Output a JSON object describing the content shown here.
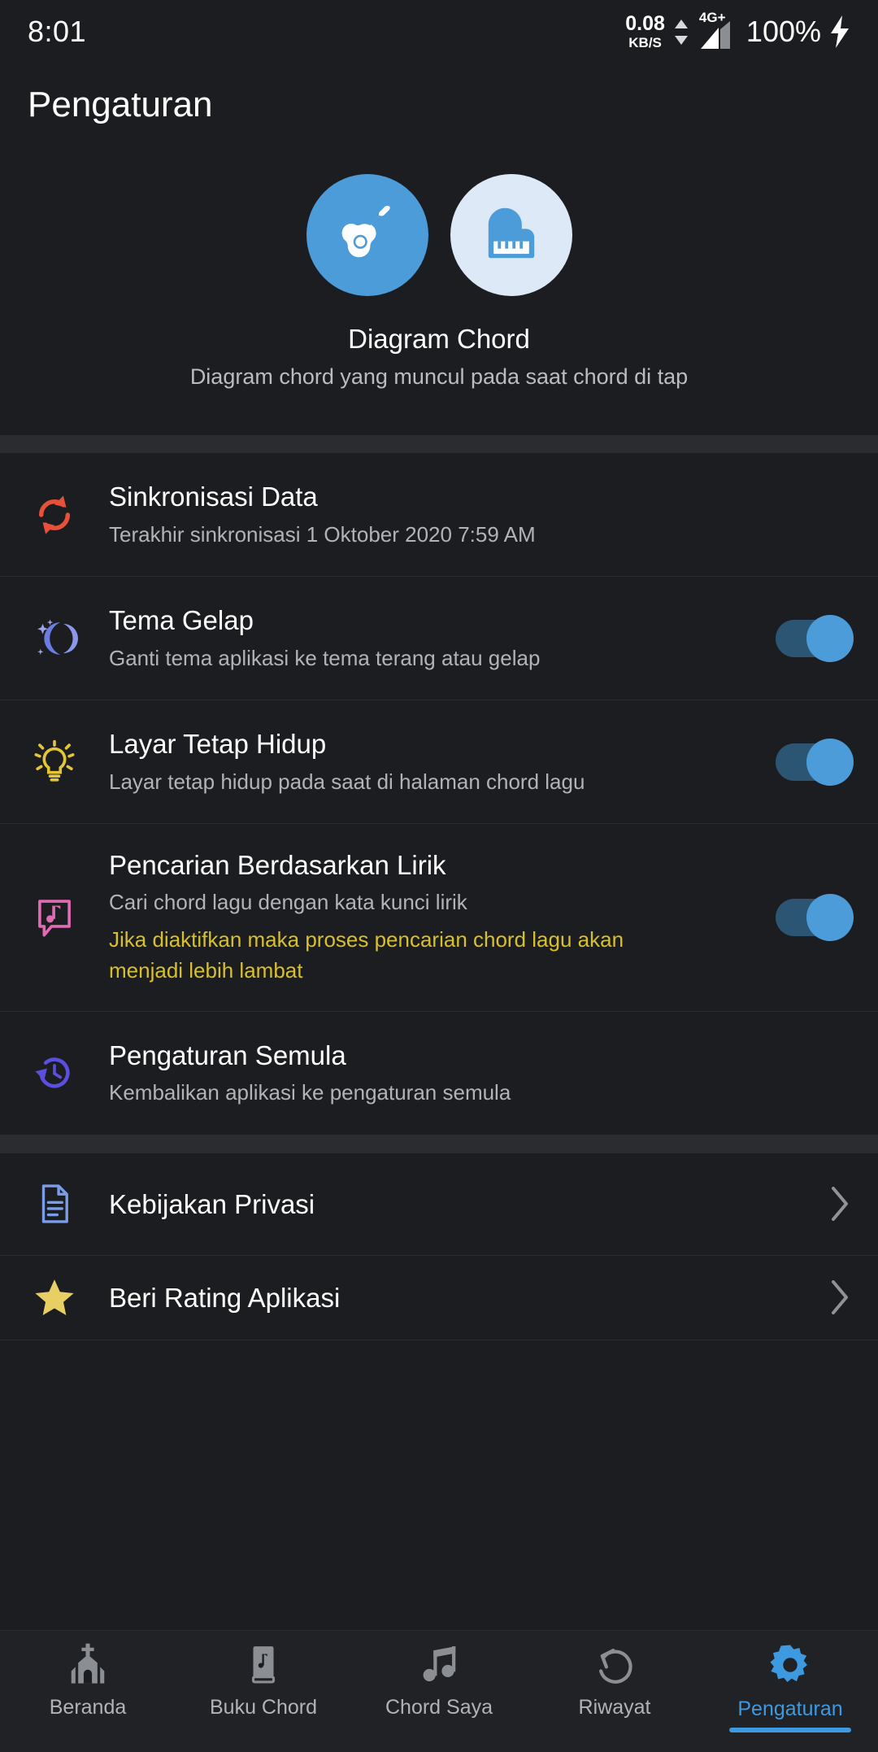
{
  "statusbar": {
    "time": "8:01",
    "net_speed_value": "0.08",
    "net_speed_unit": "KB/S",
    "network_type": "4G+",
    "battery": "100%",
    "charging_icon": "lightning-bolt-icon"
  },
  "header": {
    "title": "Pengaturan"
  },
  "hero": {
    "guitar_icon": "guitar-icon",
    "piano_icon": "piano-icon",
    "title": "Diagram Chord",
    "subtitle": "Diagram chord yang muncul pada saat chord di tap",
    "guitar_circle_color": "#4b9cd8",
    "piano_circle_color": "#dde9f6"
  },
  "settings": {
    "sync": {
      "icon": "sync-icon",
      "icon_color": "#e8503a",
      "title": "Sinkronisasi Data",
      "subtitle": "Terakhir sinkronisasi 1 Oktober 2020 7:59 AM"
    },
    "dark_theme": {
      "icon": "moon-stars-icon",
      "icon_color": "#6d7ce0",
      "title": "Tema Gelap",
      "subtitle": "Ganti tema aplikasi ke tema terang atau gelap",
      "toggle_state": "on"
    },
    "keep_screen_on": {
      "icon": "lightbulb-icon",
      "icon_color": "#e3c53a",
      "title": "Layar Tetap Hidup",
      "subtitle": "Layar tetap hidup pada saat di halaman chord lagu",
      "toggle_state": "on"
    },
    "lyric_search": {
      "icon": "music-chat-icon",
      "icon_color": "#e06bb4",
      "title": "Pencarian Berdasarkan Lirik",
      "subtitle": "Cari chord lagu dengan kata kunci lirik",
      "warning": "Jika diaktifkan maka proses pencarian chord lagu akan menjadi lebih lambat",
      "warning_color": "#d6c02e",
      "toggle_state": "on"
    },
    "reset": {
      "icon": "history-restore-icon",
      "icon_color": "#5b4fe0",
      "title": "Pengaturan Semula",
      "subtitle": "Kembalikan aplikasi ke pengaturan semula"
    },
    "privacy": {
      "icon": "document-icon",
      "icon_color": "#7b9de8",
      "title": "Kebijakan Privasi",
      "chevron": "chevron-right-icon"
    },
    "rating": {
      "icon": "star-icon",
      "icon_color": "#e8cf63",
      "title": "Beri Rating Aplikasi",
      "chevron": "chevron-right-icon"
    }
  },
  "bottom_nav": {
    "active_color": "#3d9ae0",
    "items": [
      {
        "label": "Beranda",
        "icon": "church-icon",
        "active": false
      },
      {
        "label": "Buku Chord",
        "icon": "chord-book-icon",
        "active": false
      },
      {
        "label": "Chord Saya",
        "icon": "music-note-icon",
        "active": false
      },
      {
        "label": "Riwayat",
        "icon": "undo-history-icon",
        "active": false
      },
      {
        "label": "Pengaturan",
        "icon": "gear-icon",
        "active": true
      }
    ]
  }
}
